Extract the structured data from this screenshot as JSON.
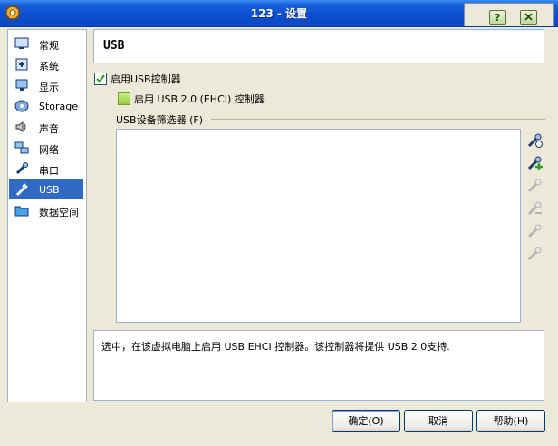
{
  "window": {
    "title": "123 - 设置",
    "help_icon": "help-icon",
    "close_icon": "close-icon"
  },
  "sidebar": {
    "items": [
      {
        "label": "常规",
        "icon": "general-icon"
      },
      {
        "label": "系统",
        "icon": "system-icon"
      },
      {
        "label": "显示",
        "icon": "display-icon"
      },
      {
        "label": "Storage",
        "icon": "storage-icon"
      },
      {
        "label": "声音",
        "icon": "audio-icon"
      },
      {
        "label": "网络",
        "icon": "network-icon"
      },
      {
        "label": "串口",
        "icon": "serial-port-icon"
      },
      {
        "label": "USB",
        "icon": "usb-icon",
        "selected": true
      },
      {
        "label": "数据空间",
        "icon": "shared-folder-icon"
      }
    ]
  },
  "page": {
    "title": "USB",
    "enable_usb_label": "启用USB控制器",
    "enable_usb_checked": true,
    "enable_ehci_label": "启用 USB 2.0 (EHCI) 控制器",
    "filters_label": "USB设备筛选器 (F)",
    "filters": [],
    "filter_buttons": [
      "add-empty-filter-icon",
      "add-filter-from-device-icon",
      "edit-filter-icon",
      "remove-filter-icon",
      "move-up-icon",
      "move-down-icon"
    ],
    "description": "选中，在该虚拟电脑上启用 USB EHCI 控制器。该控制器将提供 USB 2.0支持."
  },
  "buttons": {
    "ok": "确定(O)",
    "cancel": "取消",
    "help": "帮助(H)"
  },
  "colors": {
    "titlebar": "#0b4fd1",
    "selection": "#316ac5",
    "dialog_bg": "#ece9d8"
  }
}
